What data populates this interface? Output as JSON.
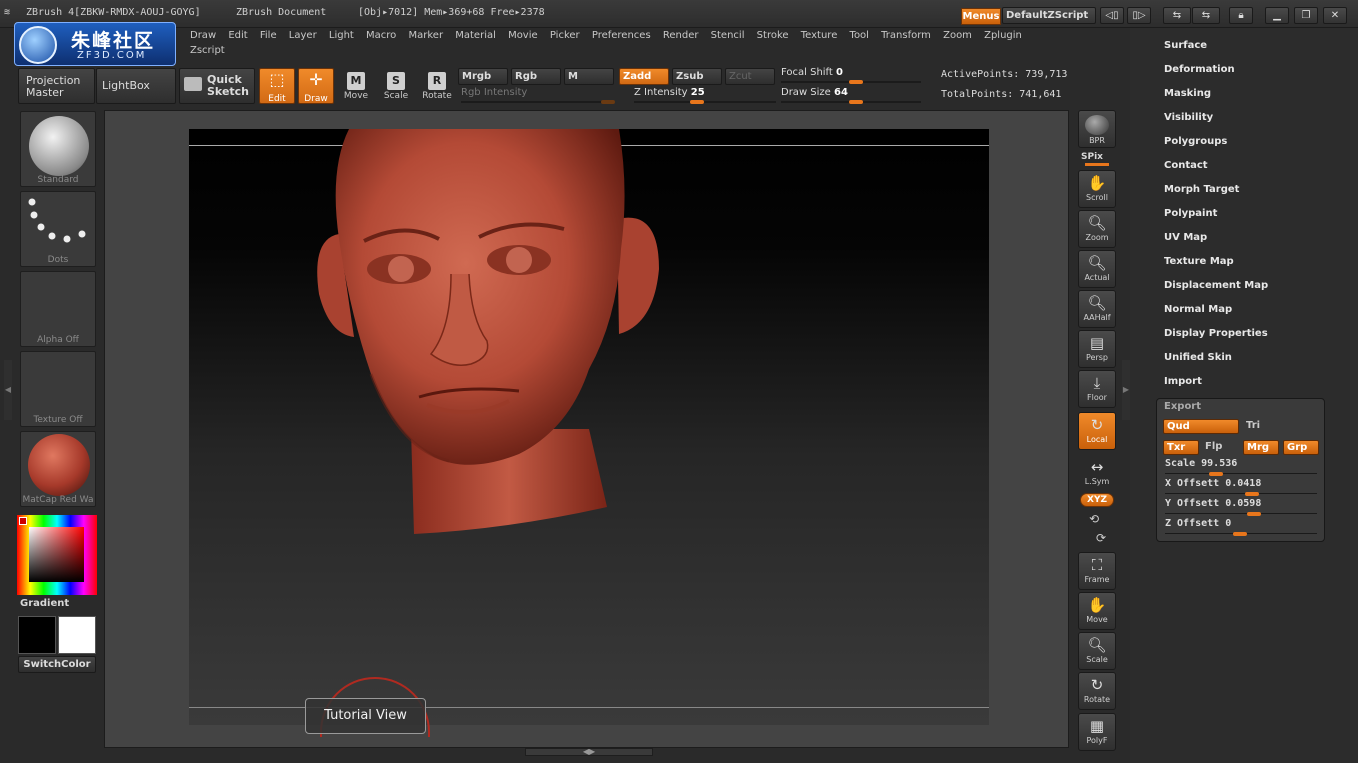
{
  "title": {
    "app": "ZBrush 4[ZBKW-RMDX-AOUJ-GOYG]",
    "doc": "ZBrush Document",
    "obj": "[Obj▸7012] Mem▸369+68 Free▸2378",
    "menus_label": "Menus",
    "script_label": "DefaultZScript"
  },
  "logo": {
    "cn": "朱峰社区",
    "en": "ZF3D.COM"
  },
  "menubar": [
    "Draw",
    "Edit",
    "File",
    "Layer",
    "Light",
    "Macro",
    "Marker",
    "Material",
    "Movie",
    "Picker",
    "Preferences",
    "Render",
    "Stencil",
    "Stroke",
    "Texture",
    "Tool",
    "Transform",
    "Zoom",
    "Zplugin",
    "Zscript"
  ],
  "toolbar": {
    "projection_master": "Projection Master",
    "lightbox": "LightBox",
    "quick_sketch": "Quick Sketch",
    "edit": "Edit",
    "draw": "Draw",
    "move": "Move",
    "scale": "Scale",
    "rotate": "Rotate",
    "mrgb": "Mrgb",
    "rgb": "Rgb",
    "m": "M",
    "zadd": "Zadd",
    "zsub": "Zsub",
    "zcut": "Zcut",
    "rgb_intensity": "Rgb Intensity",
    "z_intensity_label": "Z Intensity",
    "z_intensity": "25",
    "focal_shift_label": "Focal Shift",
    "focal_shift": "0",
    "draw_size_label": "Draw Size",
    "draw_size": "64",
    "active_points": "ActivePoints: 739,713",
    "total_points": "TotalPoints: 741,641"
  },
  "left_shelf": {
    "brush": "Standard",
    "stroke": "Dots",
    "alpha": "Alpha Off",
    "texture": "Texture Off",
    "material": "MatCap Red Wa",
    "gradient": "Gradient",
    "switchcolor": "SwitchColor"
  },
  "viewport": {
    "tutorial": "Tutorial View"
  },
  "right_shelf": {
    "bpr": "BPR",
    "spix": "SPix",
    "scroll": "Scroll",
    "zoom": "Zoom",
    "actual": "Actual",
    "aahalf": "AAHalf",
    "persp": "Persp",
    "floor": "Floor",
    "local": "Local",
    "lsym": "L.Sym",
    "xyz": "XYZ",
    "frame": "Frame",
    "move": "Move",
    "scale": "Scale",
    "rotate": "Rotate",
    "polyf": "PolyF"
  },
  "tray": {
    "items": [
      "Surface",
      "Deformation",
      "Masking",
      "Visibility",
      "Polygroups",
      "Contact",
      "Morph Target",
      "Polypaint",
      "UV Map",
      "Texture Map",
      "Displacement Map",
      "Normal Map",
      "Display Properties",
      "Unified Skin",
      "Import"
    ],
    "export": {
      "title": "Export",
      "qud": "Qud",
      "tri": "Tri",
      "txr": "Txr",
      "flp": "Flp",
      "mrg": "Mrg",
      "grp": "Grp",
      "scale_label": "Scale",
      "scale": "99.536",
      "xoff_label": "X Offsett",
      "xoff": "0.0418",
      "yoff_label": "Y Offsett",
      "yoff": "0.0598",
      "zoff_label": "Z Offsett",
      "zoff": "0"
    }
  },
  "colors": {
    "accent": "#e8761c",
    "clay": "#b44a36"
  }
}
